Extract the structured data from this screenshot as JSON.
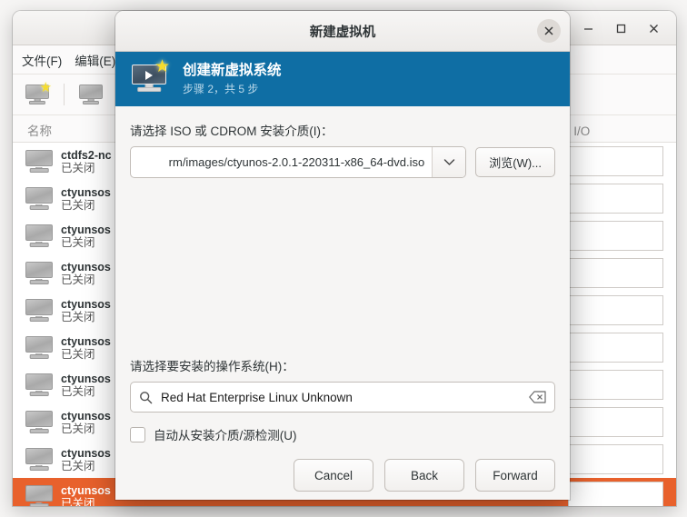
{
  "background_window": {
    "menu": [
      {
        "label": "文件(F)"
      },
      {
        "label": "编辑(E)"
      }
    ],
    "toolbar": [
      {
        "name": "new-vm",
        "icon": "monitor-star-icon"
      },
      {
        "name": "open-vm",
        "icon": "monitor-icon"
      }
    ],
    "columns": {
      "name": "名称",
      "io": "器 I/O"
    },
    "window_controls": {
      "minimize": "−",
      "maximize": "□",
      "close": "×"
    },
    "rows": [
      {
        "title": "ctdfs2-nc",
        "state": "已关闭",
        "selected": false
      },
      {
        "title": "ctyunsos",
        "state": "已关闭",
        "selected": false
      },
      {
        "title": "ctyunsos",
        "state": "已关闭",
        "selected": false
      },
      {
        "title": "ctyunsos",
        "state": "已关闭",
        "selected": false
      },
      {
        "title": "ctyunsos",
        "state": "已关闭",
        "selected": false
      },
      {
        "title": "ctyunsos",
        "state": "已关闭",
        "selected": false
      },
      {
        "title": "ctyunsos",
        "state": "已关闭",
        "selected": false
      },
      {
        "title": "ctyunsos",
        "state": "已关闭",
        "selected": false
      },
      {
        "title": "ctyunsos",
        "state": "已关闭",
        "selected": false
      },
      {
        "title": "ctyunsos",
        "state": "已关闭",
        "selected": true
      }
    ]
  },
  "dialog": {
    "title": "新建虚拟机",
    "close_label": "×",
    "banner": {
      "heading": "创建新虚拟系统",
      "subheading": "步骤 2，共 5 步",
      "icon": "monitor-play-star-icon",
      "color": "#0f6ea4"
    },
    "iso": {
      "label": "请选择 ISO 或 CDROM 安装介质(I)：",
      "value": "rm/images/ctyunos-2.0.1-220311-x86_64-dvd.iso",
      "dropdown_icon": "chevron-down-icon",
      "browse_label": "浏览(W)..."
    },
    "os": {
      "label": "请选择要安装的操作系统(H)：",
      "value": "Red Hat Enterprise Linux Unknown",
      "placeholder": "",
      "search_icon": "search-icon",
      "clear_icon": "clear-backspace-icon"
    },
    "autodetect": {
      "label": "自动从安装介质/源检测(U)",
      "checked": false
    },
    "actions": {
      "cancel": "Cancel",
      "back": "Back",
      "forward": "Forward"
    }
  },
  "colors": {
    "banner_blue": "#0f6ea4",
    "selection_orange": "#e8612c"
  }
}
